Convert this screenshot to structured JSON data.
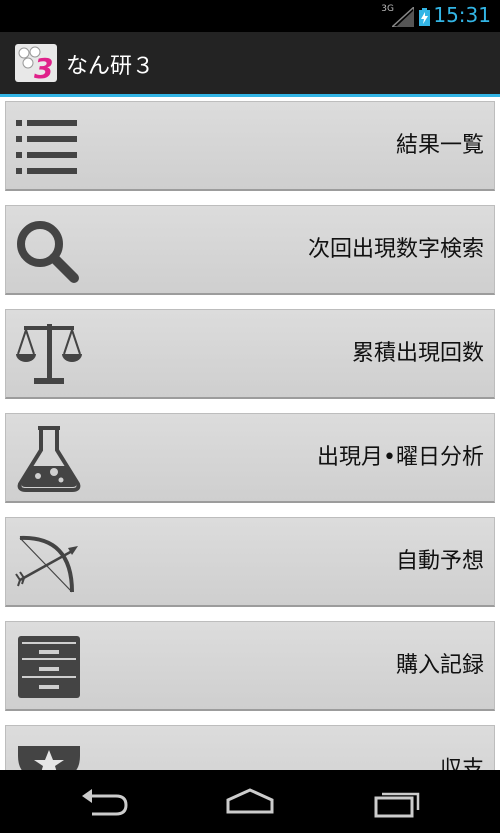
{
  "status_bar": {
    "network": "3G",
    "time": "15:31"
  },
  "action_bar": {
    "app_title": "なん研３",
    "app_icon": "numbers-3-app-icon"
  },
  "menu": {
    "items": [
      {
        "label": "結果一覧",
        "icon": "list-icon"
      },
      {
        "label": "次回出現数字検索",
        "icon": "search-icon"
      },
      {
        "label": "累積出現回数",
        "icon": "balance-scale-icon"
      },
      {
        "label": "出現月•曜日分析",
        "icon": "flask-icon"
      },
      {
        "label": "自動予想",
        "icon": "bow-arrow-icon"
      },
      {
        "label": "購入記録",
        "icon": "drawer-cabinet-icon"
      },
      {
        "label": "収支",
        "icon": "trophy-star-icon"
      }
    ]
  },
  "nav_bar": {
    "buttons": [
      "back-icon",
      "home-icon",
      "recent-apps-icon"
    ]
  }
}
